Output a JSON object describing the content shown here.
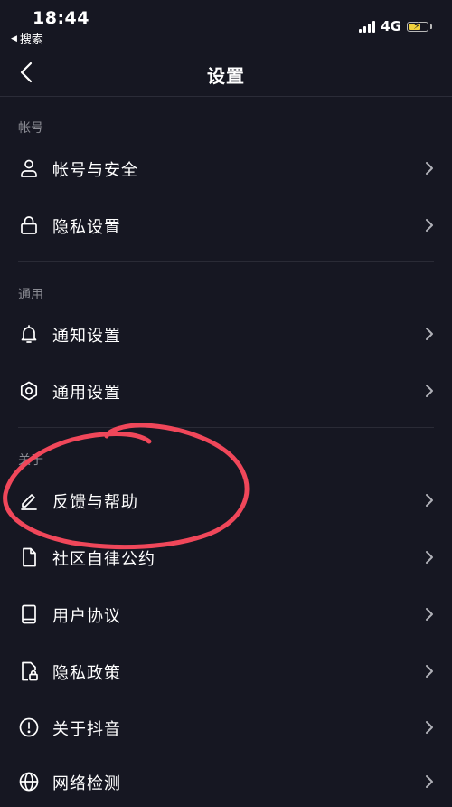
{
  "status_bar": {
    "time": "18:44",
    "back_app": "搜索",
    "network": "4G"
  },
  "nav": {
    "title": "设置"
  },
  "sections": {
    "account": {
      "header": "帐号",
      "items": [
        {
          "label": "帐号与安全",
          "icon": "person-icon"
        },
        {
          "label": "隐私设置",
          "icon": "lock-icon"
        }
      ]
    },
    "general": {
      "header": "通用",
      "items": [
        {
          "label": "通知设置",
          "icon": "bell-icon"
        },
        {
          "label": "通用设置",
          "icon": "gear-icon"
        }
      ]
    },
    "about": {
      "header": "关于",
      "items": [
        {
          "label": "反馈与帮助",
          "icon": "pencil-icon"
        },
        {
          "label": "社区自律公约",
          "icon": "document-icon"
        },
        {
          "label": "用户协议",
          "icon": "book-icon"
        },
        {
          "label": "隐私政策",
          "icon": "file-lock-icon"
        },
        {
          "label": "关于抖音",
          "icon": "info-icon"
        },
        {
          "label": "网络检测",
          "icon": "globe-icon"
        }
      ]
    }
  },
  "colors": {
    "background": "#161722",
    "section_header": "#8a8b93",
    "divider": "#2a2b36",
    "annotation": "#f0475a",
    "battery": "#f2d23c"
  }
}
